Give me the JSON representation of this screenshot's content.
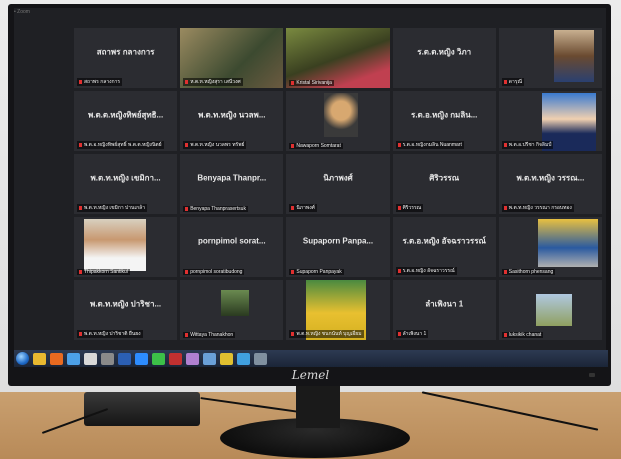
{
  "monitor": {
    "brand": "Lemel"
  },
  "window": {
    "title": "• Zoom"
  },
  "tiles": [
    {
      "name": "สถาพร กลางการ",
      "label": "สถาพร กลางการ",
      "video": false,
      "color": "#2b2c31"
    },
    {
      "name": "",
      "label": "ห.ต.ห.หญิงสุรา เสนีวงศ",
      "video": "v1",
      "color": "#2b2c31"
    },
    {
      "name": "",
      "label": "Kristal Sirivanija",
      "video": "v2",
      "color": "#2b2c31",
      "active": true
    },
    {
      "name": "ร.ต.ต.หญิง วิภา",
      "label": "",
      "video": false,
      "color": "#2b2c31"
    },
    {
      "name": "",
      "label": "ดารุณี",
      "video": "v3",
      "color": "#2b2c31"
    },
    {
      "name": "พ.ต.ต.หญิงทิพย์สุทธิ...",
      "label": "พ.ต.อ.หญิงทิพย์สุทธิ์ พ.ต.ต.หญิงนิตย์",
      "video": false,
      "color": "#2b2c31"
    },
    {
      "name": "พ.ต.ท.หญิง นวลพ...",
      "label": "พ.ต.ท.หญิง นวลพร ทรัพย์",
      "video": false,
      "color": "#2b2c31"
    },
    {
      "name": "",
      "label": "Nawaporn Somtarat",
      "video": "v4",
      "color": "#2b2c31"
    },
    {
      "name": "ร.ต.อ.หญิง กมลิน...",
      "label": "ร.ต.อ.หญิงกมลิน Nuanmart",
      "video": false,
      "color": "#2b2c31"
    },
    {
      "name": "",
      "label": "พ.ต.อ.ปรีชา กิจลิมป์",
      "video": "v5",
      "color": "#2b2c31"
    },
    {
      "name": "พ.ต.ท.หญิง เขมิกา...",
      "label": "พ.ต.ท.หญิง เขมิกา ปานเกล้า",
      "video": false,
      "color": "#2b2c31"
    },
    {
      "name": "Benyapa Thanpr...",
      "label": "Benyapa Thanprasertsuk",
      "video": false,
      "color": "#2b2c31"
    },
    {
      "name": "นิภาพงศ์",
      "label": "นิภาพงศ์",
      "video": false,
      "color": "#2b2c31"
    },
    {
      "name": "ศิริวรรณ",
      "label": "ศิริวรรณ",
      "video": false,
      "color": "#2b2c31"
    },
    {
      "name": "พ.ต.ท.หญิง วรรณ...",
      "label": "พ.ต.ท.หญิง วรรณา กรอบทอง",
      "video": false,
      "color": "#2b2c31"
    },
    {
      "name": "",
      "label": "Thipakkorn Santikul",
      "video": "v6",
      "color": "#2b2c31"
    },
    {
      "name": "pornpimol sorat...",
      "label": "pornpimol soratibudong",
      "video": false,
      "color": "#2b2c31"
    },
    {
      "name": "Supaporn Panpa...",
      "label": "Supaporn Panpayak",
      "video": false,
      "color": "#2b2c31"
    },
    {
      "name": "ร.ต.อ.หญิง อัจฉราวรรณ์",
      "label": "ร.ต.อ.หญิง อัจฉราวรรณ์",
      "video": false,
      "color": "#2b2c31"
    },
    {
      "name": "",
      "label": "Sasithorn phensang",
      "video": "v7",
      "color": "#2b2c31"
    },
    {
      "name": "พ.ต.ท.หญิง ปาริชา...",
      "label": "พ.ต.ท.หญิง ปาริชาติ ยืนยง",
      "video": false,
      "color": "#2b2c31"
    },
    {
      "name": "",
      "label": "Wittaya Thanakhon",
      "video": "v8",
      "color": "#2b2c31"
    },
    {
      "name": "",
      "label": "พ.ต.ท.หญิง ชนกนันท์ บุญเอี่ยม",
      "video": "v9",
      "color": "#2b2c31"
    },
    {
      "name": "ลำเพิงนา 1",
      "label": "ลำเพิงนา 1",
      "video": false,
      "color": "#2b2c31"
    },
    {
      "name": "",
      "label": "luksikik chanat",
      "video": "v10",
      "color": "#2b2c31"
    }
  ],
  "taskbar": {
    "icons": [
      {
        "name": "start-orb-icon",
        "color": "#1e6ac8"
      },
      {
        "name": "folder-icon",
        "color": "#e8b830"
      },
      {
        "name": "media-player-icon",
        "color": "#e86a20"
      },
      {
        "name": "explorer-icon",
        "color": "#4ca0e8"
      },
      {
        "name": "chrome-icon",
        "color": "#d8d8d8"
      },
      {
        "name": "network-icon",
        "color": "#8a8a8a"
      },
      {
        "name": "word-icon",
        "color": "#2b5fb4"
      },
      {
        "name": "zoom-icon",
        "color": "#2d8cff"
      },
      {
        "name": "line-icon",
        "color": "#3cc048"
      },
      {
        "name": "app-icon",
        "color": "#c03030"
      },
      {
        "name": "photo-icon",
        "color": "#b080d0"
      },
      {
        "name": "app-icon-2",
        "color": "#6aa0d8"
      },
      {
        "name": "chrome-icon-2",
        "color": "#e0c030"
      },
      {
        "name": "display-icon",
        "color": "#40a0e0"
      },
      {
        "name": "settings-icon",
        "color": "#8090a0"
      }
    ]
  }
}
